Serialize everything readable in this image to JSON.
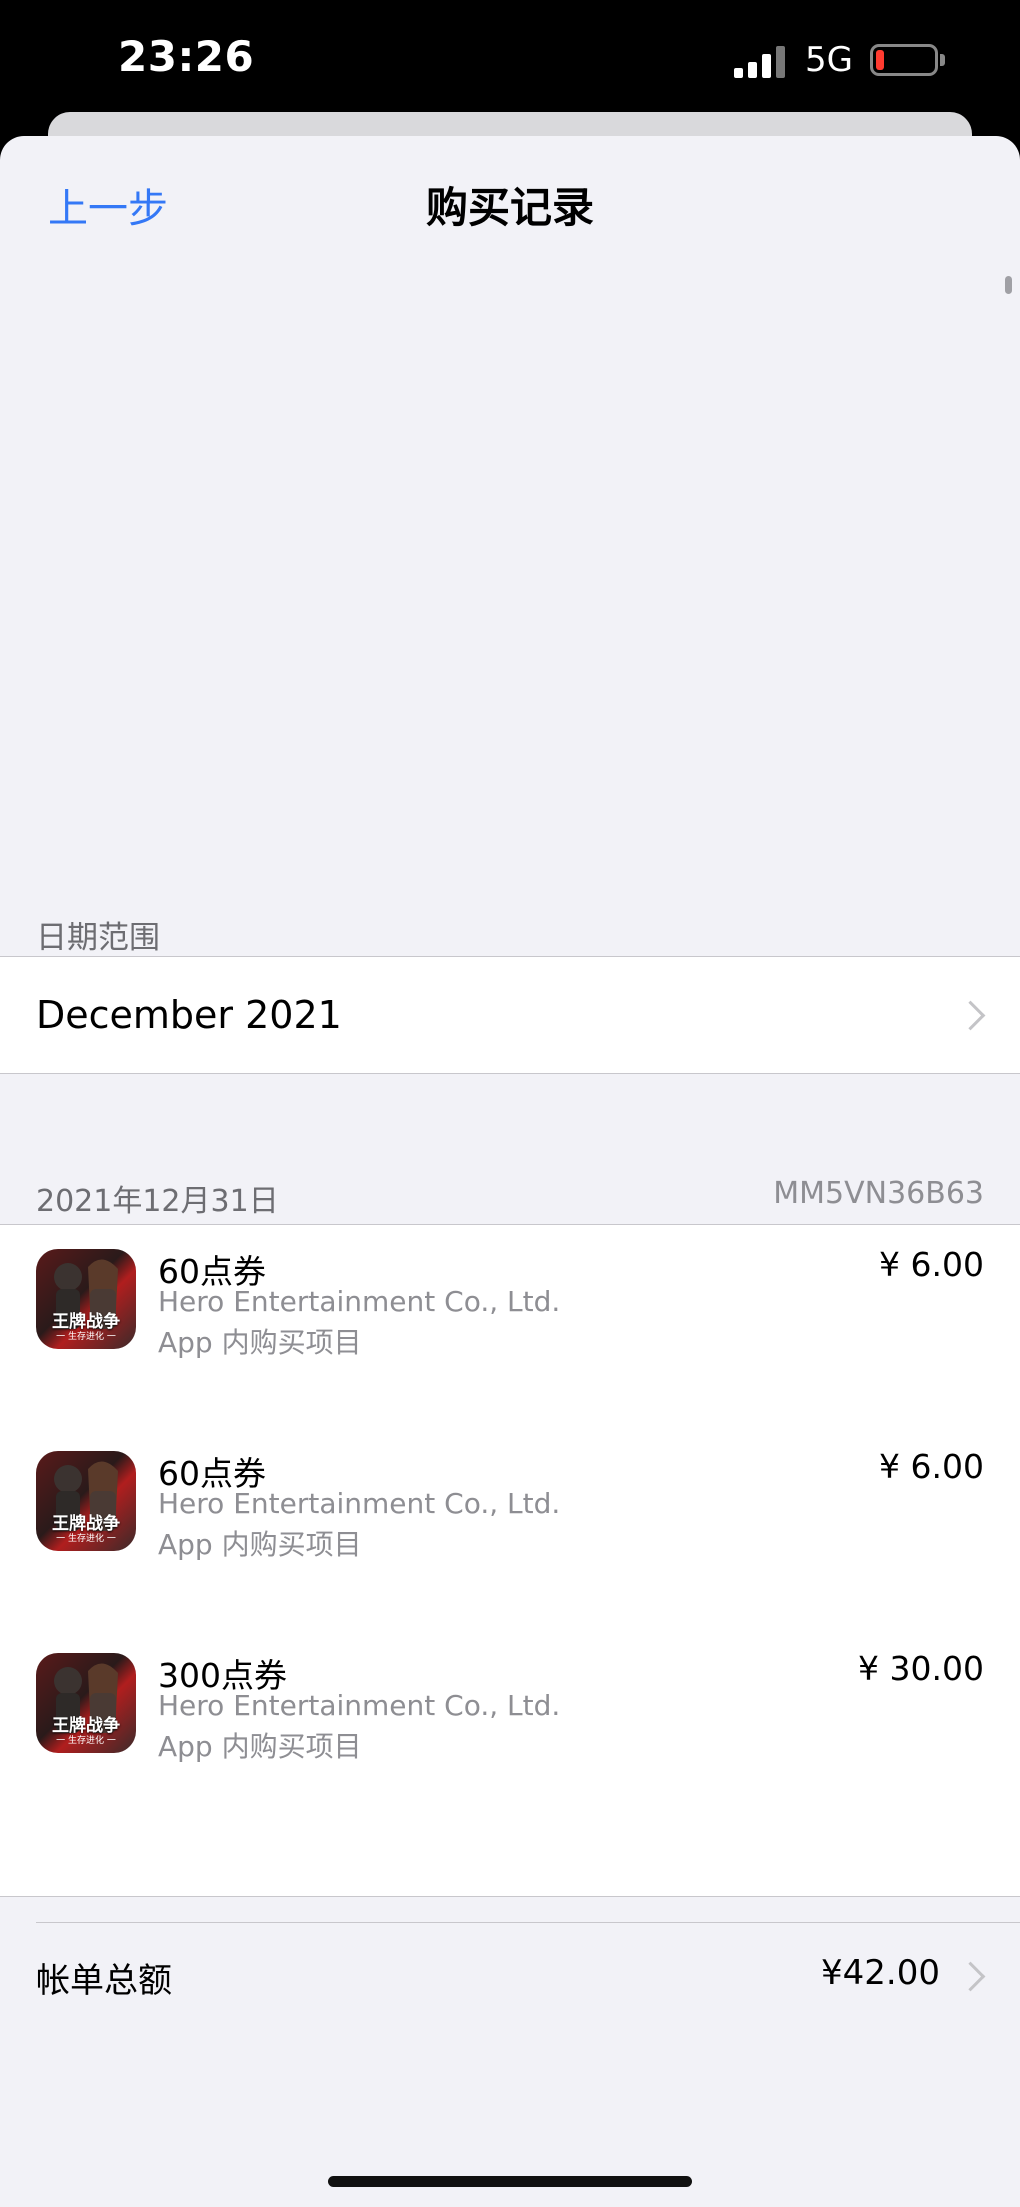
{
  "status_bar": {
    "time": "23:26",
    "network": "5G",
    "battery_level": 0.1
  },
  "nav": {
    "back_label": "上一步",
    "title": "购买记录"
  },
  "date_range": {
    "section_label": "日期范围",
    "value": "December 2021"
  },
  "transaction": {
    "date": "2021年12月31日",
    "order_id": "MM5VN36B63",
    "items": [
      {
        "name": "60点券",
        "developer": "Hero Entertainment Co., Ltd.",
        "type": "App 内购买项目",
        "price": "¥ 6.00",
        "icon_text": "王牌战争",
        "icon_sub": "一 生存进化 一"
      },
      {
        "name": "60点券",
        "developer": "Hero Entertainment Co., Ltd.",
        "type": "App 内购买项目",
        "price": "¥ 6.00",
        "icon_text": "王牌战争",
        "icon_sub": "一 生存进化 一"
      },
      {
        "name": "300点券",
        "developer": "Hero Entertainment Co., Ltd.",
        "type": "App 内购买项目",
        "price": "¥ 30.00",
        "icon_text": "王牌战争",
        "icon_sub": "一 生存进化 一"
      }
    ],
    "total_label": "帐单总额",
    "total_value": "¥42.00"
  },
  "colors": {
    "accent": "#3478f6",
    "background": "#f2f2f7",
    "battery_low": "#ff3b30"
  },
  "icons": [
    "chevron-right-icon",
    "signal-icon",
    "battery-icon",
    "app-icon"
  ]
}
